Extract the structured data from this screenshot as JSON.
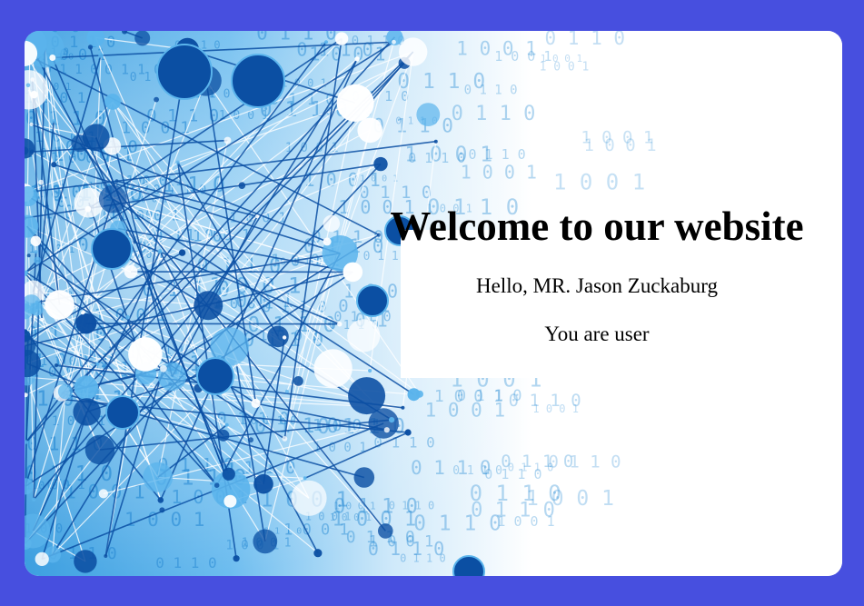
{
  "page": {
    "title": "Welcome to our website",
    "greeting": "Hello, MR. Jason Zuckaburg",
    "role_text": "You are user"
  },
  "colors": {
    "page_background": "#474fdf",
    "card_background": "#ffffff",
    "network_dark_blue": "#0b4fa3",
    "network_light_blue": "#5bb4ec"
  },
  "background_image": {
    "icon": "network-nodes-binary-illustration"
  }
}
